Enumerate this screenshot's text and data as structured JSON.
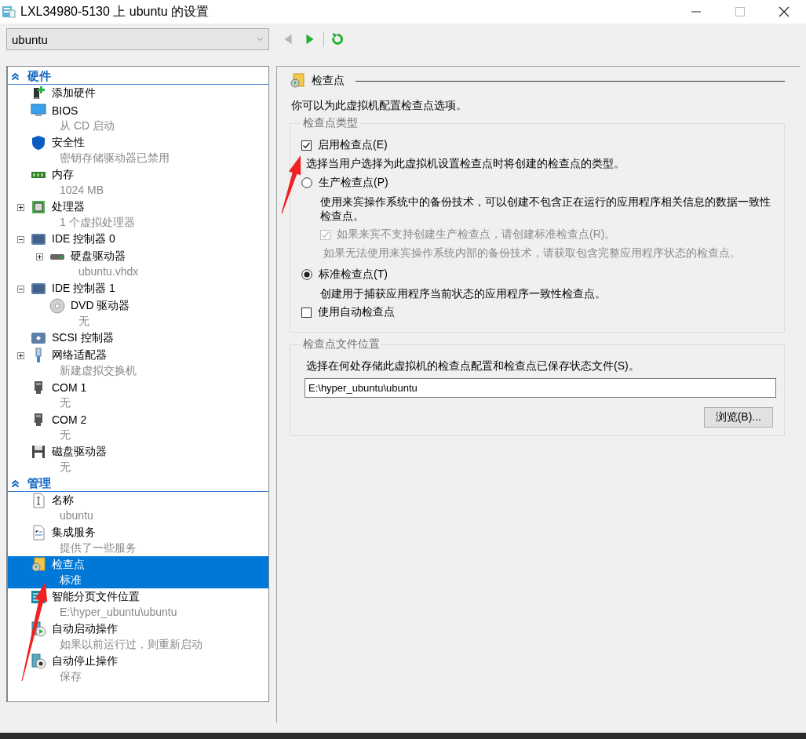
{
  "window": {
    "title": "LXL34980-5130 上 ubuntu 的设置"
  },
  "vm_selector": {
    "value": "ubuntu"
  },
  "toolbar": [
    {
      "kind": "back",
      "disabled": true
    },
    {
      "kind": "forward",
      "disabled": false
    },
    {
      "kind": "refresh",
      "disabled": false
    }
  ],
  "sidebar": {
    "sections": [
      {
        "title": "硬件",
        "expanded": true,
        "items": [
          {
            "label": "添加硬件",
            "selected": false
          },
          {
            "label": "BIOS",
            "detail": "从 CD 启动",
            "selected": false
          },
          {
            "label": "安全性",
            "detail": "密钥存储驱动器已禁用",
            "selected": false
          },
          {
            "label": "内存",
            "detail": "1024 MB",
            "selected": false
          },
          {
            "label": "处理器",
            "detail": "1 个虚拟处理器",
            "expanded": false,
            "selected": false
          },
          {
            "label": "IDE 控制器 0",
            "expanded": true,
            "selected": false,
            "children": [
              {
                "label": "硬盘驱动器",
                "detail": "ubuntu.vhdx",
                "expanded": false,
                "selected": false
              }
            ]
          },
          {
            "label": "IDE 控制器 1",
            "expanded": true,
            "selected": false,
            "children": [
              {
                "label": "DVD 驱动器",
                "detail": "无",
                "selected": false
              }
            ]
          },
          {
            "label": "SCSI 控制器",
            "selected": false
          },
          {
            "label": "网络适配器",
            "detail": "新建虚拟交换机",
            "expanded": false,
            "selected": false
          },
          {
            "label": "COM 1",
            "detail": "无",
            "selected": false
          },
          {
            "label": "COM 2",
            "detail": "无",
            "selected": false
          },
          {
            "label": "磁盘驱动器",
            "detail": "无",
            "selected": false
          }
        ]
      },
      {
        "title": "管理",
        "expanded": true,
        "items": [
          {
            "label": "名称",
            "detail": "ubuntu",
            "selected": false
          },
          {
            "label": "集成服务",
            "detail": "提供了一些服务",
            "selected": false
          },
          {
            "label": "检查点",
            "detail": "标准",
            "selected": true
          },
          {
            "label": "智能分页文件位置",
            "detail": "E:\\hyper_ubuntu\\ubuntu",
            "selected": false
          },
          {
            "label": "自动启动操作",
            "detail": "如果以前运行过，则重新启动",
            "selected": false
          },
          {
            "label": "自动停止操作",
            "detail": "保存",
            "selected": false
          }
        ]
      }
    ]
  },
  "panel": {
    "title": "检查点",
    "intro": "你可以为此虚拟机配置检查点选项。",
    "type_group": {
      "title": "检查点类型",
      "controls": [
        {
          "kind": "checkbox",
          "label": "启用检查点(E)",
          "checked": true
        },
        {
          "kind": "note",
          "text": "选择当用户选择为此虚拟机设置检查点时将创建的检查点的类型。"
        },
        {
          "kind": "radio",
          "label": "生产检查点(P)",
          "selected": false,
          "description": "使用来宾操作系统中的备份技术，可以创建不包含正在运行的应用程序相关信息的数据一致性检查点。",
          "suboption": {
            "label": "如果来宾不支持创建生产检查点，请创建标准检查点(R)。",
            "checked": true,
            "disabled": true,
            "note": "如果无法使用来宾操作系统内部的备份技术，请获取包含完整应用程序状态的检查点。"
          }
        },
        {
          "kind": "radio",
          "label": "标准检查点(T)",
          "selected": true,
          "description": "创建用于捕获应用程序当前状态的应用程序一致性检查点。"
        },
        {
          "kind": "checkbox",
          "label": "使用自动检查点",
          "checked": false
        }
      ]
    },
    "file_group": {
      "title": "检查点文件位置",
      "description": "选择在何处存储此虚拟机的检查点配置和检查点已保存状态文件(S)。",
      "path": "E:\\hyper_ubuntu\\ubuntu",
      "browse": "浏览(B)..."
    }
  }
}
